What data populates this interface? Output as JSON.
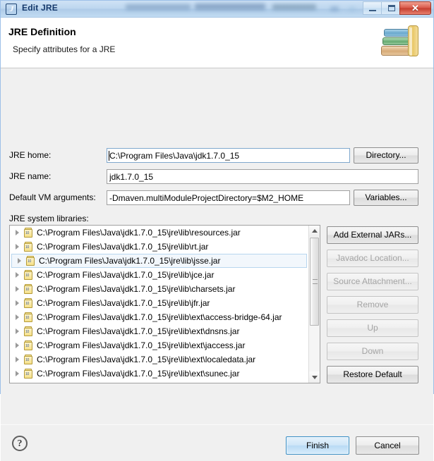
{
  "window": {
    "title": "Edit JRE",
    "app_icon": "eclipse-icon",
    "controls": {
      "minimize": "minimize-icon",
      "maximize": "maximize-icon",
      "close": "✕"
    }
  },
  "banner": {
    "title": "JRE Definition",
    "subtitle": "Specify attributes for a JRE",
    "icon": "books-icon"
  },
  "form": {
    "jre_home": {
      "label": "JRE home:",
      "value": "C:\\Program Files\\Java\\jdk1.7.0_15",
      "button": "Directory..."
    },
    "jre_name": {
      "label": "JRE name:",
      "value": "jdk1.7.0_15"
    },
    "vm_args": {
      "label": "Default VM arguments:",
      "value": "-Dmaven.multiModuleProjectDirectory=$M2_HOME",
      "button": "Variables..."
    },
    "libraries_label": "JRE system libraries:"
  },
  "libraries": [
    {
      "path": "C:\\Program Files\\Java\\jdk1.7.0_15\\jre\\lib\\resources.jar",
      "selected": false
    },
    {
      "path": "C:\\Program Files\\Java\\jdk1.7.0_15\\jre\\lib\\rt.jar",
      "selected": false
    },
    {
      "path": "C:\\Program Files\\Java\\jdk1.7.0_15\\jre\\lib\\jsse.jar",
      "selected": true
    },
    {
      "path": "C:\\Program Files\\Java\\jdk1.7.0_15\\jre\\lib\\jce.jar",
      "selected": false
    },
    {
      "path": "C:\\Program Files\\Java\\jdk1.7.0_15\\jre\\lib\\charsets.jar",
      "selected": false
    },
    {
      "path": "C:\\Program Files\\Java\\jdk1.7.0_15\\jre\\lib\\jfr.jar",
      "selected": false
    },
    {
      "path": "C:\\Program Files\\Java\\jdk1.7.0_15\\jre\\lib\\ext\\access-bridge-64.jar",
      "selected": false
    },
    {
      "path": "C:\\Program Files\\Java\\jdk1.7.0_15\\jre\\lib\\ext\\dnsns.jar",
      "selected": false
    },
    {
      "path": "C:\\Program Files\\Java\\jdk1.7.0_15\\jre\\lib\\ext\\jaccess.jar",
      "selected": false
    },
    {
      "path": "C:\\Program Files\\Java\\jdk1.7.0_15\\jre\\lib\\ext\\localedata.jar",
      "selected": false
    },
    {
      "path": "C:\\Program Files\\Java\\jdk1.7.0_15\\jre\\lib\\ext\\sunec.jar",
      "selected": false
    }
  ],
  "side_buttons": [
    {
      "label": "Add External JARs...",
      "enabled": true
    },
    {
      "label": "Javadoc Location...",
      "enabled": false
    },
    {
      "label": "Source Attachment...",
      "enabled": false
    },
    {
      "label": "Remove",
      "enabled": false
    },
    {
      "label": "Up",
      "enabled": false
    },
    {
      "label": "Down",
      "enabled": false
    },
    {
      "label": "Restore Default",
      "enabled": true
    }
  ],
  "footer": {
    "help": "?",
    "finish": "Finish",
    "cancel": "Cancel"
  },
  "colors": {
    "titlebar": "#bed7ef",
    "dialog_bg": "#f0f0f0",
    "default_button_border": "#3c8fc4",
    "selection_bg": "#f2f7fc",
    "close_button": "#c33d2e"
  }
}
